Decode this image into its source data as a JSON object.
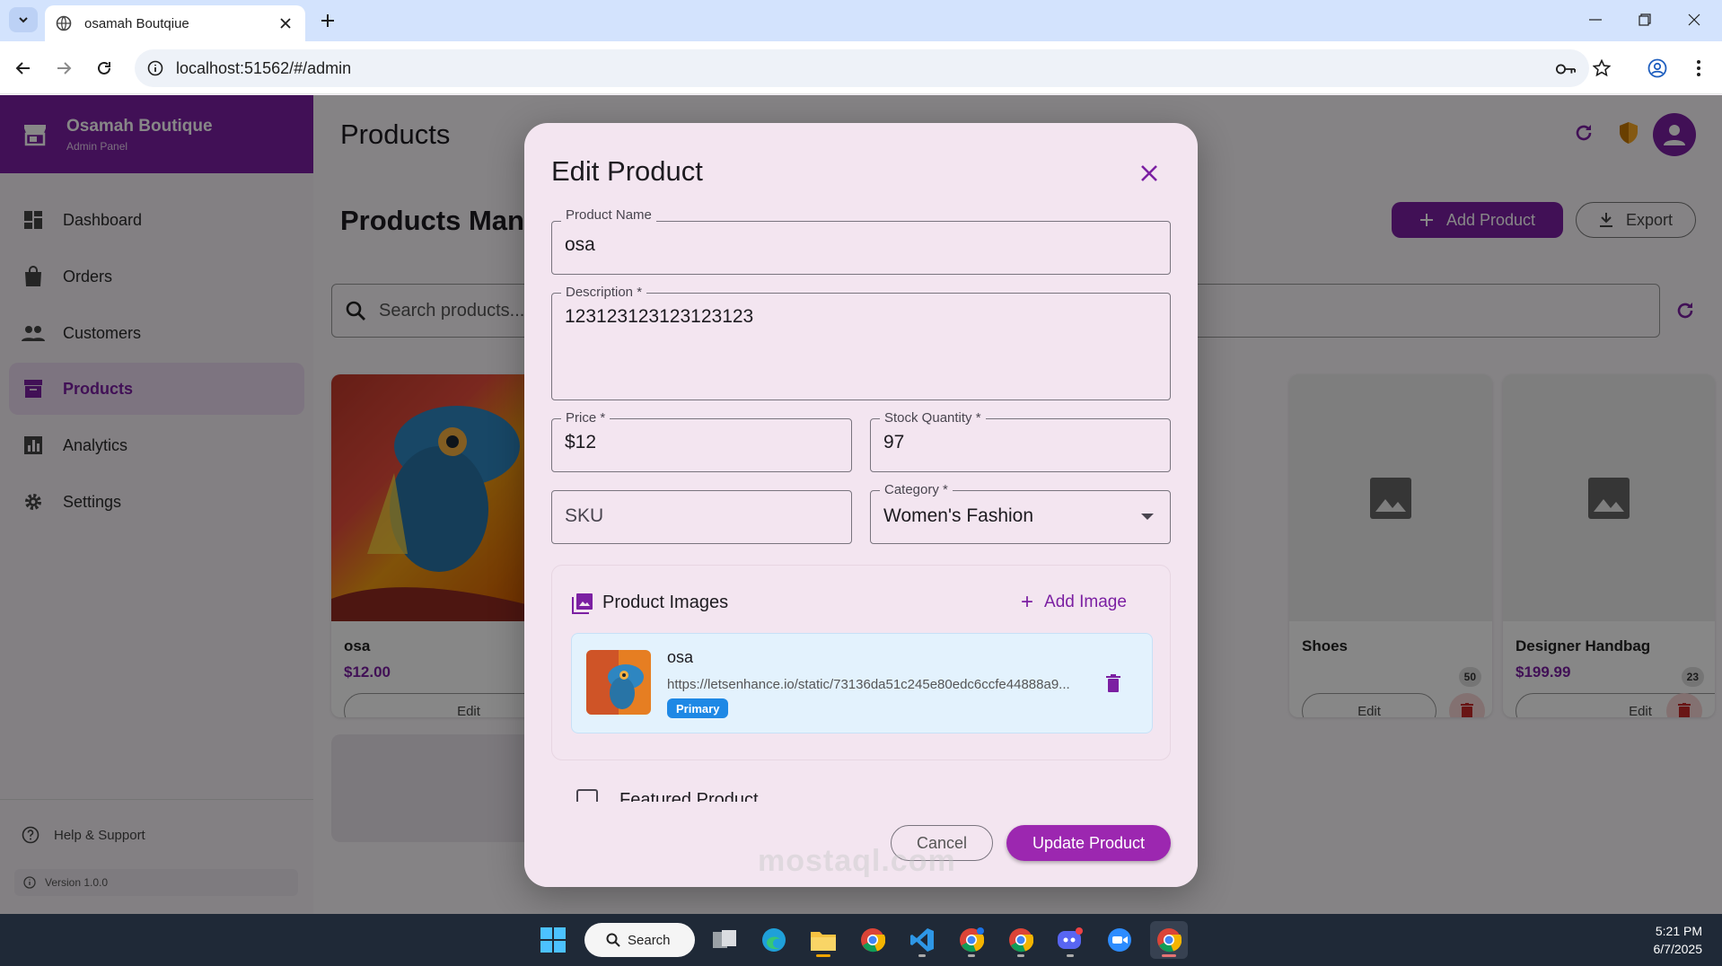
{
  "browser": {
    "tab_title": "osamah Boutqiue",
    "url": "localhost:51562/#/admin"
  },
  "sidebar": {
    "brand_name": "Osamah Boutique",
    "brand_sub": "Admin Panel",
    "items": [
      {
        "label": "Dashboard",
        "icon": "dashboard-icon"
      },
      {
        "label": "Orders",
        "icon": "shopping-bag-icon"
      },
      {
        "label": "Customers",
        "icon": "people-icon"
      },
      {
        "label": "Products",
        "icon": "inventory-icon",
        "active": true
      },
      {
        "label": "Analytics",
        "icon": "bar-chart-icon"
      },
      {
        "label": "Settings",
        "icon": "gear-icon"
      }
    ],
    "help_label": "Help & Support",
    "version": "Version 1.0.0"
  },
  "main": {
    "page_title": "Products",
    "sub_title": "Products Management",
    "add_product_label": "Add Product",
    "export_label": "Export",
    "search_placeholder": "Search products...",
    "cards": [
      {
        "name": "osa",
        "price": "$12.00",
        "stock": "",
        "edit_label": "Edit"
      },
      {
        "name": "Shoes",
        "price": "",
        "stock": "50",
        "edit_label": "Edit"
      },
      {
        "name": "Designer Handbag",
        "price": "$199.99",
        "stock": "23",
        "edit_label": "Edit"
      }
    ]
  },
  "dialog": {
    "title": "Edit Product",
    "product_name_label": "Product Name",
    "product_name_value": "osa",
    "description_label": "Description *",
    "description_value": "123123123123123123",
    "price_label": "Price *",
    "price_value": "$12",
    "stock_label": "Stock Quantity *",
    "stock_value": "97",
    "sku_placeholder": "SKU",
    "category_label": "Category *",
    "category_value": "Women's Fashion",
    "images_heading": "Product Images",
    "add_image_label": "Add Image",
    "image": {
      "name": "osa",
      "url": "https://letsenhance.io/static/73136da51c245e80edc6ccfe44888a9...",
      "badge": "Primary"
    },
    "featured_label": "Featured Product",
    "cancel_label": "Cancel",
    "update_label": "Update Product"
  },
  "watermark": "mostaql.com",
  "taskbar": {
    "search_label": "Search",
    "time": "5:21 PM",
    "date": "6/7/2025"
  },
  "colors": {
    "brand_purple": "#7b1fa2",
    "accent_purple": "#9c27b0",
    "primary_badge_blue": "#1e88e5",
    "dialog_bg": "#f3e5f0"
  }
}
